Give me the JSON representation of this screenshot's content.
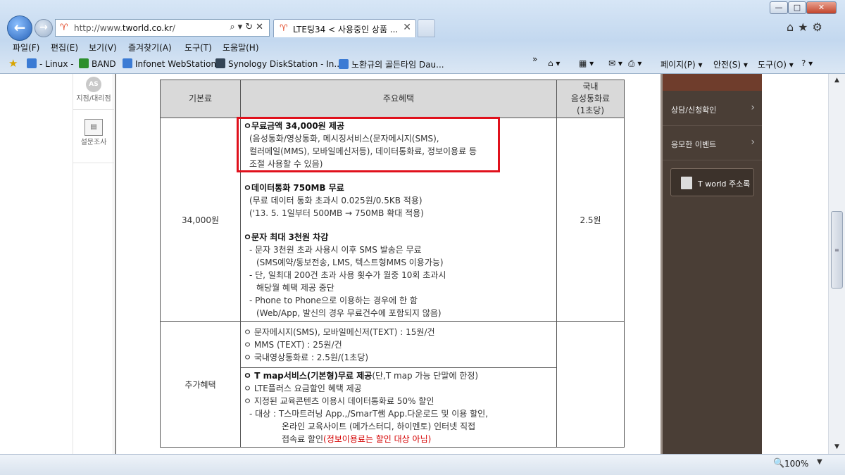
{
  "browser": {
    "window_buttons": {
      "minimize": "—",
      "maximize": "□",
      "close": "✕"
    },
    "address_bar": {
      "url_prefix": "http://www.",
      "url_domain": "tworld.co.kr",
      "url_suffix": "/",
      "tools": "⌕▾↻✕"
    },
    "tabs": [
      {
        "label": "LTE팅34 < 사용중인 상품 ...",
        "close": "✕"
      }
    ],
    "right_icons": "⌂★⚙",
    "menu": [
      "파일(F)",
      "편집(E)",
      "보기(V)",
      "즐겨찾기(A)",
      "도구(T)",
      "도움말(H)"
    ],
    "favorites": [
      {
        "label": "- Linux -",
        "icon_name": "ie-page-icon"
      },
      {
        "label": "BAND",
        "icon_name": "band-icon"
      },
      {
        "label": "Infonet WebStation",
        "icon_name": "ie-page-icon"
      },
      {
        "label": "Synology DiskStation - In...",
        "icon_name": "dsm-icon"
      },
      {
        "label": "노환규의 골든타임  Dau...",
        "icon_name": "ie-page-icon"
      }
    ],
    "toolbar": {
      "more": "»",
      "home": "⌂ ▾",
      "feed": "▦ ▾",
      "mail": "✉ ▾",
      "print": "⎙ ▾",
      "page": "페이지(P) ▾",
      "safety": "안전(S) ▾",
      "tools": "도구(O) ▾",
      "help": "? ▾"
    },
    "status": {
      "zoom": "100%",
      "zoom_icon": "🔍",
      "zoom_drop": "▼"
    }
  },
  "left_side": {
    "items": [
      {
        "icon": "AS",
        "label": "지점/대리점"
      },
      {
        "icon": "▤",
        "label": "설문조사"
      }
    ]
  },
  "right_panel": {
    "items": [
      {
        "label": "상담/신청확인",
        "arrow": "›"
      },
      {
        "label": "응모한 이벤트",
        "arrow": "›"
      }
    ],
    "addressbook": "T world 주소록"
  },
  "table": {
    "headers": {
      "col1": "기본료",
      "col2": "주요혜택",
      "col3_line1": "국내",
      "col3_line2": "음성통화료",
      "col3_line3": "(1초당)"
    },
    "row1": {
      "fee": "34,000원",
      "rate": "2.5원",
      "b1_title": "ㅇ무료금액 34,000원 제공",
      "b1_l1": "(음성통화/영상통화, 메시징서비스(문자메시지(SMS),",
      "b1_l2": "컬러메일(MMS), 모바일메신저등), 데이터통화료, 정보이용료 등",
      "b1_l3": "조절 사용할 수 있음)",
      "b2_title": "ㅇ데이터통화 750MB 무료",
      "b2_l1": "(무료 데이터 통화 초과시 0.025원/0.5KB 적용)",
      "b2_l2": "('13. 5. 1일부터 500MB → 750MB 확대 적용)",
      "b3_title": "ㅇ문자 최대 3천원 차감",
      "b3_l1": "- 문자 3천원 초과 사용시 이후 SMS 발송은 무료",
      "b3_l2": "(SMS예약/동보전송, LMS, 텍스트형MMS 이용가능)",
      "b3_l3": "- 단, 일최대 200건 초과 사용 횟수가 월중 10회 초과시",
      "b3_l4": "해당월 혜택 제공 중단",
      "b3_l5": "- Phone to Phone으로 이용하는 경우에 한 함",
      "b3_l6": "(Web/App, 발신의 경우 무료건수에 포함되지 않음)"
    },
    "row2": {
      "label": "추가혜택",
      "a_l1": "ㅇ 문자메시지(SMS), 모바일메신저(TEXT) : 15원/건",
      "a_l2": "ㅇ MMS (TEXT) : 25원/건",
      "a_l3": "ㅇ 국내영상통화료 : 2.5원/(1초당)",
      "b_l1_bold": "ㅇ T map서비스(기본형)무료 제공",
      "b_l1_rest": "(단,T map 가능 단말에 한정)",
      "b_l2": "ㅇ LTE플러스 요금할인 혜택 제공",
      "b_l3": "ㅇ 지정된 교육콘텐츠 이용시 데이터통화료 50% 할인",
      "b_l4": "- 대상 : T스마트러닝 App.,/SmarT쌤 App.다운로드 및 이용 할인,",
      "b_l5": "온라인 교육사이트 (메가스터디, 하이멘토) 인터넷 직접",
      "b_l6_a": "접속료 할인",
      "b_l6_red": "(정보이용료는 할인 대상 아님)"
    }
  },
  "colors": {
    "highlight": "#e0111c",
    "header_bg": "#d9d9d9",
    "panel": "#4a3e36"
  }
}
